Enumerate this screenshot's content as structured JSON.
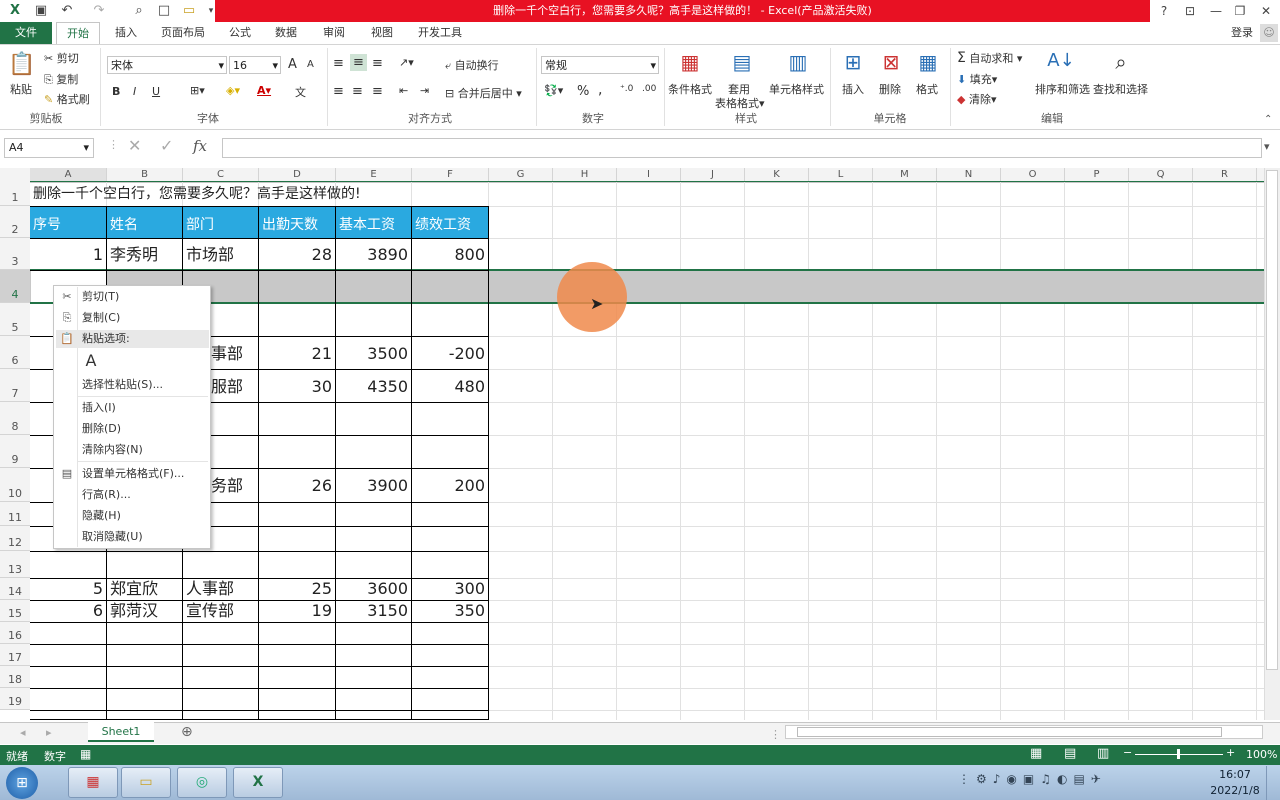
{
  "window": {
    "title": "删除一千个空白行，您需要多久呢？高手是这样做的！ - Excel(产品激活失败)",
    "help": "?",
    "user": "登录",
    "qat_icons": [
      "excel-logo-icon",
      "save-icon",
      "undo-icon",
      "redo-icon",
      "print-preview-icon",
      "new-file-icon",
      "open-icon",
      "customize-qat-icon"
    ]
  },
  "tabs": [
    "文件",
    "开始",
    "插入",
    "页面布局",
    "公式",
    "数据",
    "审阅",
    "视图",
    "开发工具"
  ],
  "ribbon": {
    "clipboard": {
      "paste": "粘贴",
      "cut": "剪切",
      "copy": "复制",
      "format_painter": "格式刷",
      "label": "剪贴板"
    },
    "font": {
      "name": "宋体",
      "size": "16",
      "bold": "B",
      "italic": "I",
      "underline": "U",
      "grow": "A",
      "shrink": "A",
      "wen": "文",
      "label": "字体"
    },
    "alignment": {
      "wrap": "自动换行",
      "merge": "合并后居中",
      "label": "对齐方式"
    },
    "number": {
      "format": "常规",
      "percent": "%",
      "comma": ",",
      "label": "数字"
    },
    "styles": {
      "conditional": "条件格式",
      "table_format_1": "套用",
      "table_format_2": "表格格式",
      "cell_styles": "单元格样式",
      "label": "样式"
    },
    "cells": {
      "insert": "插入",
      "delete": "删除",
      "format": "格式",
      "label": "单元格"
    },
    "editing": {
      "autosum": "自动求和",
      "fill": "填充",
      "clear": "清除",
      "sort": "排序和筛选",
      "find": "查找和选择",
      "label": "编辑"
    }
  },
  "formula_bar": {
    "name_box": "A4",
    "fx": "fx",
    "value": ""
  },
  "sheet": {
    "columns": [
      "A",
      "B",
      "C",
      "D",
      "E",
      "F",
      "G",
      "H",
      "I",
      "J",
      "K",
      "L",
      "M",
      "N",
      "O",
      "P",
      "Q",
      "R"
    ],
    "rows": [
      "1",
      "2",
      "3",
      "4",
      "5",
      "6",
      "7",
      "8",
      "9",
      "10",
      "11",
      "12",
      "13",
      "14",
      "15",
      "16",
      "17",
      "18",
      "19"
    ],
    "title": "删除一千个空白行，您需要多久呢？高手是这样做的!",
    "headers": [
      "序号",
      "姓名",
      "部门",
      "出勤天数",
      "基本工资",
      "绩效工资"
    ],
    "r3": [
      "1",
      "李秀明",
      "市场部",
      "28",
      "3890",
      "800"
    ],
    "r6": [
      "事部",
      "21",
      "3500",
      "-200"
    ],
    "r7": [
      "服部",
      "30",
      "4350",
      "480"
    ],
    "r10": [
      "务部",
      "26",
      "3900",
      "200"
    ],
    "r14": [
      "5",
      "郑宜欣",
      "人事部",
      "25",
      "3600",
      "300"
    ],
    "r15": [
      "6",
      "郭菏汉",
      "宣传部",
      "19",
      "3150",
      "350"
    ]
  },
  "context_menu": {
    "cut": "剪切(T)",
    "copy": "复制(C)",
    "paste_options": "粘贴选项:",
    "paste_special": "选择性粘贴(S)...",
    "insert": "插入(I)",
    "delete": "删除(D)",
    "clear": "清除内容(N)",
    "format_cells": "设置单元格格式(F)...",
    "row_height": "行高(R)...",
    "hide": "隐藏(H)",
    "unhide": "取消隐藏(U)"
  },
  "sheet_tabs": {
    "active": "Sheet1",
    "add": "⊕"
  },
  "status": {
    "ready": "就绪",
    "num": "数字",
    "zoom": "100%"
  },
  "taskbar": {
    "time": "16:07",
    "date": "2022/1/8"
  },
  "colors": {
    "excel_green": "#217346",
    "title_red": "#e81123",
    "header_blue": "#2aa9e0",
    "selection_gray": "#c8c8c8",
    "cursor_orange": "#f08a4b"
  }
}
